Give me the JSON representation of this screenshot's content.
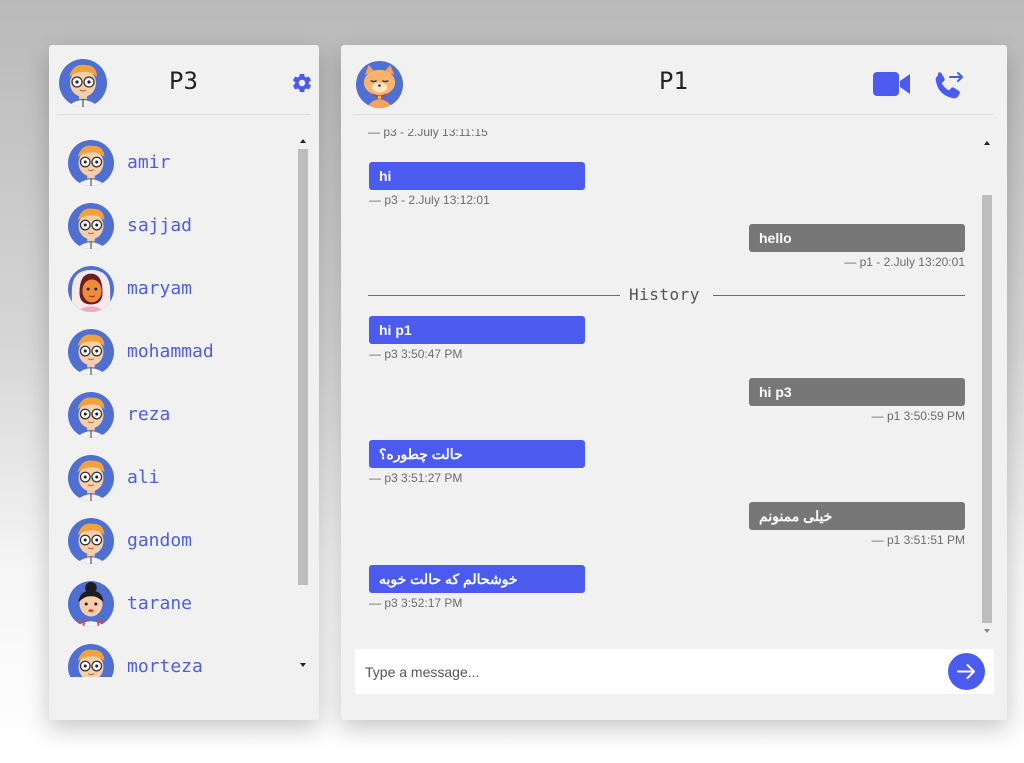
{
  "colors": {
    "accent": "#4b5bef",
    "incoming_bubble": "#4b5bef",
    "outgoing_bubble": "#777777",
    "contact_name": "#4f5de0",
    "panel_bg": "#f1f1f2"
  },
  "sidebar": {
    "user_name": "P3",
    "avatar_icon": "boy-glasses-avatar",
    "settings_icon": "gear-icon",
    "contacts": [
      {
        "name": "amir",
        "avatar": "boy-glasses-avatar"
      },
      {
        "name": "sajjad",
        "avatar": "boy-glasses-avatar"
      },
      {
        "name": "maryam",
        "avatar": "girl-hijab-avatar"
      },
      {
        "name": "mohammad",
        "avatar": "boy-glasses-avatar"
      },
      {
        "name": "reza",
        "avatar": "boy-glasses-avatar"
      },
      {
        "name": "ali",
        "avatar": "boy-glasses-avatar"
      },
      {
        "name": "gandom",
        "avatar": "boy-glasses-avatar"
      },
      {
        "name": "tarane",
        "avatar": "girl-bun-avatar"
      },
      {
        "name": "morteza",
        "avatar": "boy-glasses-avatar"
      }
    ]
  },
  "chat": {
    "title": "P1",
    "avatar_icon": "cat-avatar",
    "video_icon": "video-camera-icon",
    "call_icon": "phone-call-icon",
    "top_partial_meta": "— p3 - 2.July 13:11:15",
    "messages": [
      {
        "text": "hi",
        "meta": "— p3 - 2.July 13:12:01",
        "side": "left"
      },
      {
        "text": "hello",
        "meta": "— p1 - 2.July 13:20:01",
        "side": "right"
      }
    ],
    "separator_label": "History",
    "history": [
      {
        "text": "hi p1",
        "meta": "— p3 3:50:47 PM",
        "side": "left"
      },
      {
        "text": "hi p3",
        "meta": "— p1 3:50:59 PM",
        "side": "right"
      },
      {
        "text": "حالت چطوره؟",
        "meta": "— p3 3:51:27 PM",
        "side": "left"
      },
      {
        "text": "خیلی ممنونم",
        "meta": "— p1 3:51:51 PM",
        "side": "right"
      },
      {
        "text": "خوشحالم که حالت خوبه",
        "meta": "— p3 3:52:17 PM",
        "side": "left"
      }
    ],
    "composer": {
      "placeholder": "Type a message...",
      "value": "",
      "send_icon": "arrow-right-icon"
    }
  }
}
